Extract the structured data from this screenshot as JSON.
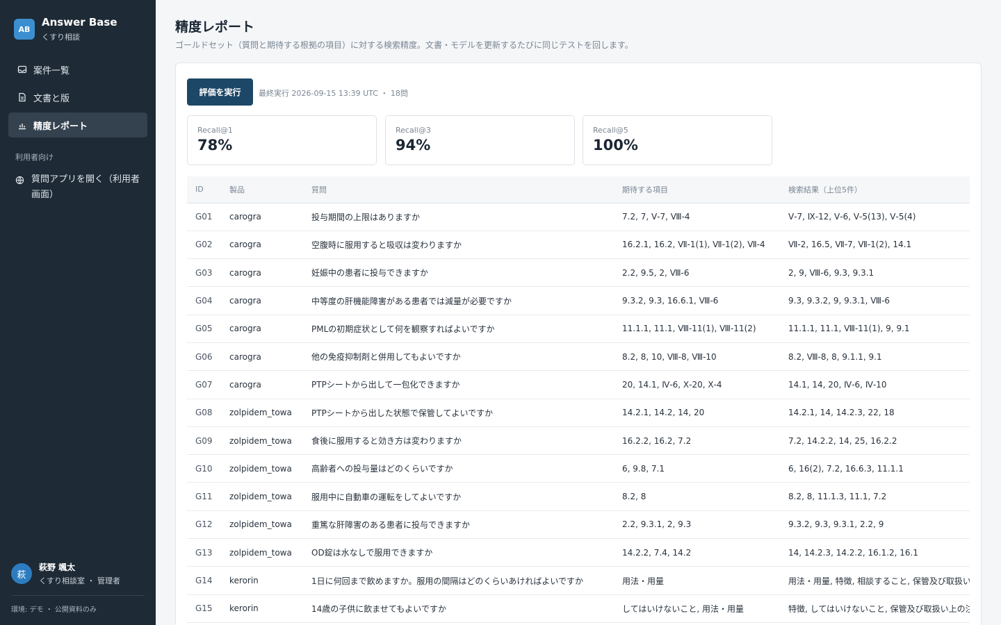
{
  "sidebar": {
    "logo": "AB",
    "app_title": "Answer Base",
    "app_sub": "くすり相談",
    "nav": [
      {
        "label": "案件一覧",
        "icon": "inbox-icon"
      },
      {
        "label": "文書と版",
        "icon": "document-icon"
      },
      {
        "label": "精度レポート",
        "icon": "chart-icon",
        "active": true
      }
    ],
    "section_label": "利用者向け",
    "external_link": "質問アプリを開く（利用者画面）",
    "user": {
      "initial": "萩",
      "name": "萩野 颯太",
      "role": "くすり相談室 ・ 管理者"
    },
    "env": "環境: デモ ・ 公開資料のみ"
  },
  "page": {
    "title": "精度レポート",
    "description": "ゴールドセット（質問と期待する根拠の項目）に対する検索精度。文書・モデルを更新するたびに同じテストを回します。"
  },
  "eval": {
    "run_button": "評価を実行",
    "last_run": "最終実行 2026-09-15 13:39 UTC ・ 18問",
    "metrics": [
      {
        "label": "Recall@1",
        "value": "78%"
      },
      {
        "label": "Recall@3",
        "value": "94%"
      },
      {
        "label": "Recall@5",
        "value": "100%"
      }
    ]
  },
  "table": {
    "headers": [
      "ID",
      "製品",
      "質問",
      "期待する項目",
      "検索結果（上位5件）"
    ],
    "rows": [
      [
        "G01",
        "carogra",
        "投与期間の上限はありますか",
        "7.2, 7, Ⅴ-7, Ⅷ-4",
        "Ⅴ-7, Ⅸ-12, Ⅴ-6, Ⅴ-5(13), Ⅴ-5(4)"
      ],
      [
        "G02",
        "carogra",
        "空腹時に服用すると吸収は変わりますか",
        "16.2.1, 16.2, Ⅶ-1(1), Ⅶ-1(2), Ⅶ-4",
        "Ⅶ-2, 16.5, Ⅶ-7, Ⅶ-1(2), 14.1"
      ],
      [
        "G03",
        "carogra",
        "妊娠中の患者に投与できますか",
        "2.2, 9.5, 2, Ⅷ-6",
        "2, 9, Ⅷ-6, 9.3, 9.3.1"
      ],
      [
        "G04",
        "carogra",
        "中等度の肝機能障害がある患者では減量が必要ですか",
        "9.3.2, 9.3, 16.6.1, Ⅷ-6",
        "9.3, 9.3.2, 9, 9.3.1, Ⅷ-6"
      ],
      [
        "G05",
        "carogra",
        "PMLの初期症状として何を観察すればよいですか",
        "11.1.1, 11.1, Ⅷ-11(1), Ⅷ-11(2)",
        "11.1.1, 11.1, Ⅷ-11(1), 9, 9.1"
      ],
      [
        "G06",
        "carogra",
        "他の免疫抑制剤と併用してもよいですか",
        "8.2, 8, 10, Ⅷ-8, Ⅷ-10",
        "8.2, Ⅷ-8, 8, 9.1.1, 9.1"
      ],
      [
        "G07",
        "carogra",
        "PTPシートから出して一包化できますか",
        "20, 14.1, Ⅳ-6, Ⅹ-20, Ⅹ-4",
        "14.1, 14, 20, Ⅳ-6, Ⅳ-10"
      ],
      [
        "G08",
        "zolpidem_towa",
        "PTPシートから出した状態で保管してよいですか",
        "14.2.1, 14.2, 14, 20",
        "14.2.1, 14, 14.2.3, 22, 18"
      ],
      [
        "G09",
        "zolpidem_towa",
        "食後に服用すると効き方は変わりますか",
        "16.2.2, 16.2, 7.2",
        "7.2, 14.2.2, 14, 25, 16.2.2"
      ],
      [
        "G10",
        "zolpidem_towa",
        "高齢者への投与量はどのくらいですか",
        "6, 9.8, 7.1",
        "6, 16(2), 7.2, 16.6.3, 11.1.1"
      ],
      [
        "G11",
        "zolpidem_towa",
        "服用中に自動車の運転をしてよいですか",
        "8.2, 8",
        "8.2, 8, 11.1.3, 11.1, 7.2"
      ],
      [
        "G12",
        "zolpidem_towa",
        "重篤な肝障害のある患者に投与できますか",
        "2.2, 9.3.1, 2, 9.3",
        "9.3.2, 9.3, 9.3.1, 2.2, 9"
      ],
      [
        "G13",
        "zolpidem_towa",
        "OD錠は水なしで服用できますか",
        "14.2.2, 7.4, 14.2",
        "14, 14.2.3, 14.2.2, 16.1.2, 16.1"
      ],
      [
        "G14",
        "kerorin",
        "1日に何回まで飲めますか。服用の間隔はどのくらいあければよいですか",
        "用法・用量",
        "用法・用量, 特徴, 相談すること, 保管及び取扱い上の注意"
      ],
      [
        "G15",
        "kerorin",
        "14歳の子供に飲ませてもよいですか",
        "してはいけないこと, 用法・用量",
        "特徴, してはいけないこと, 保管及び取扱い上の注意"
      ]
    ]
  }
}
